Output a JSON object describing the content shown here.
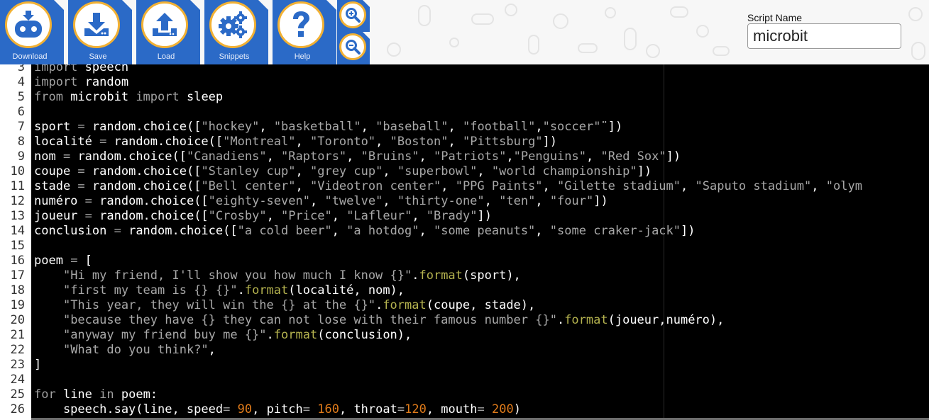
{
  "toolbar": {
    "buttons": [
      {
        "id": "download",
        "label": "Download",
        "icon": "microbit-icon"
      },
      {
        "id": "save",
        "label": "Save",
        "icon": "save-download-icon"
      },
      {
        "id": "load",
        "label": "Load",
        "icon": "load-upload-icon"
      },
      {
        "id": "snippets",
        "label": "Snippets",
        "icon": "gears-icon"
      },
      {
        "id": "help",
        "label": "Help",
        "icon": "question-icon"
      }
    ],
    "zoom_in_icon": "zoom-in-icon",
    "zoom_out_icon": "zoom-out-icon"
  },
  "script_name": {
    "label": "Script Name",
    "value": "microbit"
  },
  "colors": {
    "toolbar_blue": "#2b6ac7",
    "button_ring": "#f2b134",
    "editor_bg": "#000000",
    "keyword": "#a0a0a0",
    "string": "#a8a8a8",
    "number": "#e07b1a",
    "format_method": "#b5b34f"
  },
  "editor": {
    "lines": [
      {
        "n": "3",
        "tokens": [
          {
            "t": "import",
            "c": "kw"
          },
          {
            "t": " speech"
          }
        ]
      },
      {
        "n": "4",
        "tokens": [
          {
            "t": "import",
            "c": "kw"
          },
          {
            "t": " random"
          }
        ]
      },
      {
        "n": "5",
        "tokens": [
          {
            "t": "from",
            "c": "kw"
          },
          {
            "t": " microbit "
          },
          {
            "t": "import",
            "c": "kw"
          },
          {
            "t": " sleep"
          }
        ]
      },
      {
        "n": "6",
        "tokens": []
      },
      {
        "n": "7",
        "tokens": [
          {
            "t": "sport "
          },
          {
            "t": "=",
            "c": "op"
          },
          {
            "t": " random.choice(["
          },
          {
            "t": "\"hockey\"",
            "c": "str"
          },
          {
            "t": ", "
          },
          {
            "t": "\"basketball\"",
            "c": "str"
          },
          {
            "t": ", "
          },
          {
            "t": "\"baseball\"",
            "c": "str"
          },
          {
            "t": ", "
          },
          {
            "t": "\"football\"",
            "c": "str"
          },
          {
            "t": ","
          },
          {
            "t": "\"soccer\"",
            "c": "str"
          },
          {
            "t": "¨])"
          }
        ]
      },
      {
        "n": "8",
        "tokens": [
          {
            "t": "localité "
          },
          {
            "t": "=",
            "c": "op"
          },
          {
            "t": " random.choice(["
          },
          {
            "t": "\"Montreal\"",
            "c": "str"
          },
          {
            "t": ", "
          },
          {
            "t": "\"Toronto\"",
            "c": "str"
          },
          {
            "t": ", "
          },
          {
            "t": "\"Boston\"",
            "c": "str"
          },
          {
            "t": ", "
          },
          {
            "t": "\"Pittsburg\"",
            "c": "str"
          },
          {
            "t": "])"
          }
        ]
      },
      {
        "n": "9",
        "tokens": [
          {
            "t": "nom "
          },
          {
            "t": "=",
            "c": "op"
          },
          {
            "t": " random.choice(["
          },
          {
            "t": "\"Canadiens\"",
            "c": "str"
          },
          {
            "t": ", "
          },
          {
            "t": "\"Raptors\"",
            "c": "str"
          },
          {
            "t": ", "
          },
          {
            "t": "\"Bruins\"",
            "c": "str"
          },
          {
            "t": ", "
          },
          {
            "t": "\"Patriots\"",
            "c": "str"
          },
          {
            "t": ","
          },
          {
            "t": "\"Penguins\"",
            "c": "str"
          },
          {
            "t": ", "
          },
          {
            "t": "\"Red Sox\"",
            "c": "str"
          },
          {
            "t": "])"
          }
        ]
      },
      {
        "n": "10",
        "tokens": [
          {
            "t": "coupe "
          },
          {
            "t": "=",
            "c": "op"
          },
          {
            "t": " random.choice(["
          },
          {
            "t": "\"Stanley cup\"",
            "c": "str"
          },
          {
            "t": ", "
          },
          {
            "t": "\"grey cup\"",
            "c": "str"
          },
          {
            "t": ", "
          },
          {
            "t": "\"superbowl\"",
            "c": "str"
          },
          {
            "t": ", "
          },
          {
            "t": "\"world championship\"",
            "c": "str"
          },
          {
            "t": "])"
          }
        ]
      },
      {
        "n": "11",
        "tokens": [
          {
            "t": "stade "
          },
          {
            "t": "=",
            "c": "op"
          },
          {
            "t": " random.choice(["
          },
          {
            "t": "\"Bell center\"",
            "c": "str"
          },
          {
            "t": ", "
          },
          {
            "t": "\"Videotron center\"",
            "c": "str"
          },
          {
            "t": ", "
          },
          {
            "t": "\"PPG Paints\"",
            "c": "str"
          },
          {
            "t": ", "
          },
          {
            "t": "\"Gilette stadium\"",
            "c": "str"
          },
          {
            "t": ", "
          },
          {
            "t": "\"Saputo stadium\"",
            "c": "str"
          },
          {
            "t": ", "
          },
          {
            "t": "\"olym",
            "c": "str"
          }
        ]
      },
      {
        "n": "12",
        "tokens": [
          {
            "t": "numéro "
          },
          {
            "t": "=",
            "c": "op"
          },
          {
            "t": " random.choice(["
          },
          {
            "t": "\"eighty-seven\"",
            "c": "str"
          },
          {
            "t": ", "
          },
          {
            "t": "\"twelve\"",
            "c": "str"
          },
          {
            "t": ", "
          },
          {
            "t": "\"thirty-one\"",
            "c": "str"
          },
          {
            "t": ", "
          },
          {
            "t": "\"ten\"",
            "c": "str"
          },
          {
            "t": ", "
          },
          {
            "t": "\"four\"",
            "c": "str"
          },
          {
            "t": "])"
          }
        ]
      },
      {
        "n": "13",
        "tokens": [
          {
            "t": "joueur "
          },
          {
            "t": "=",
            "c": "op"
          },
          {
            "t": " random.choice(["
          },
          {
            "t": "\"Crosby\"",
            "c": "str"
          },
          {
            "t": ", "
          },
          {
            "t": "\"Price\"",
            "c": "str"
          },
          {
            "t": ", "
          },
          {
            "t": "\"Lafleur\"",
            "c": "str"
          },
          {
            "t": ", "
          },
          {
            "t": "\"Brady\"",
            "c": "str"
          },
          {
            "t": "])"
          }
        ]
      },
      {
        "n": "14",
        "tokens": [
          {
            "t": "conclusion "
          },
          {
            "t": "=",
            "c": "op"
          },
          {
            "t": " random.choice(["
          },
          {
            "t": "\"a cold beer\"",
            "c": "str"
          },
          {
            "t": ", "
          },
          {
            "t": "\"a hotdog\"",
            "c": "str"
          },
          {
            "t": ", "
          },
          {
            "t": "\"some peanuts\"",
            "c": "str"
          },
          {
            "t": ", "
          },
          {
            "t": "\"some craker-jack\"",
            "c": "str"
          },
          {
            "t": "])"
          }
        ]
      },
      {
        "n": "15",
        "tokens": []
      },
      {
        "n": "16",
        "tokens": [
          {
            "t": "poem "
          },
          {
            "t": "=",
            "c": "op"
          },
          {
            "t": " ["
          }
        ]
      },
      {
        "n": "17",
        "tokens": [
          {
            "t": "    "
          },
          {
            "t": "\"Hi my friend, I'll show you how much I know {}\"",
            "c": "str"
          },
          {
            "t": "."
          },
          {
            "t": "format",
            "c": "fmt"
          },
          {
            "t": "(sport),"
          }
        ]
      },
      {
        "n": "18",
        "tokens": [
          {
            "t": "    "
          },
          {
            "t": "\"first my team is {} {}\"",
            "c": "str"
          },
          {
            "t": "."
          },
          {
            "t": "format",
            "c": "fmt"
          },
          {
            "t": "(localité, nom),"
          }
        ]
      },
      {
        "n": "19",
        "tokens": [
          {
            "t": "    "
          },
          {
            "t": "\"This year, they will win the {} at the {}\"",
            "c": "str"
          },
          {
            "t": "."
          },
          {
            "t": "format",
            "c": "fmt"
          },
          {
            "t": "(coupe, stade),"
          }
        ]
      },
      {
        "n": "20",
        "tokens": [
          {
            "t": "    "
          },
          {
            "t": "\"because they have {} they can not lose with their famous number {}\"",
            "c": "str"
          },
          {
            "t": "."
          },
          {
            "t": "format",
            "c": "fmt"
          },
          {
            "t": "(joueur,numéro),"
          }
        ]
      },
      {
        "n": "21",
        "tokens": [
          {
            "t": "    "
          },
          {
            "t": "\"anyway my friend buy me {}\"",
            "c": "str"
          },
          {
            "t": "."
          },
          {
            "t": "format",
            "c": "fmt"
          },
          {
            "t": "(conclusion),"
          }
        ]
      },
      {
        "n": "22",
        "tokens": [
          {
            "t": "    "
          },
          {
            "t": "\"What do you think?\"",
            "c": "str"
          },
          {
            "t": ","
          }
        ]
      },
      {
        "n": "23",
        "tokens": [
          {
            "t": "]"
          }
        ]
      },
      {
        "n": "24",
        "tokens": []
      },
      {
        "n": "25",
        "tokens": [
          {
            "t": "for",
            "c": "kw"
          },
          {
            "t": " line "
          },
          {
            "t": "in",
            "c": "kw"
          },
          {
            "t": " poem:"
          }
        ]
      },
      {
        "n": "26",
        "tokens": [
          {
            "t": "    speech.say(line, speed"
          },
          {
            "t": "=",
            "c": "op"
          },
          {
            "t": " "
          },
          {
            "t": "90",
            "c": "num"
          },
          {
            "t": ", pitch"
          },
          {
            "t": "=",
            "c": "op"
          },
          {
            "t": " "
          },
          {
            "t": "160",
            "c": "num"
          },
          {
            "t": ", throat"
          },
          {
            "t": "=",
            "c": "op"
          },
          {
            "t": "120",
            "c": "num"
          },
          {
            "t": ", mouth"
          },
          {
            "t": "=",
            "c": "op"
          },
          {
            "t": " "
          },
          {
            "t": "200",
            "c": "num"
          },
          {
            "t": ")"
          }
        ]
      }
    ]
  }
}
